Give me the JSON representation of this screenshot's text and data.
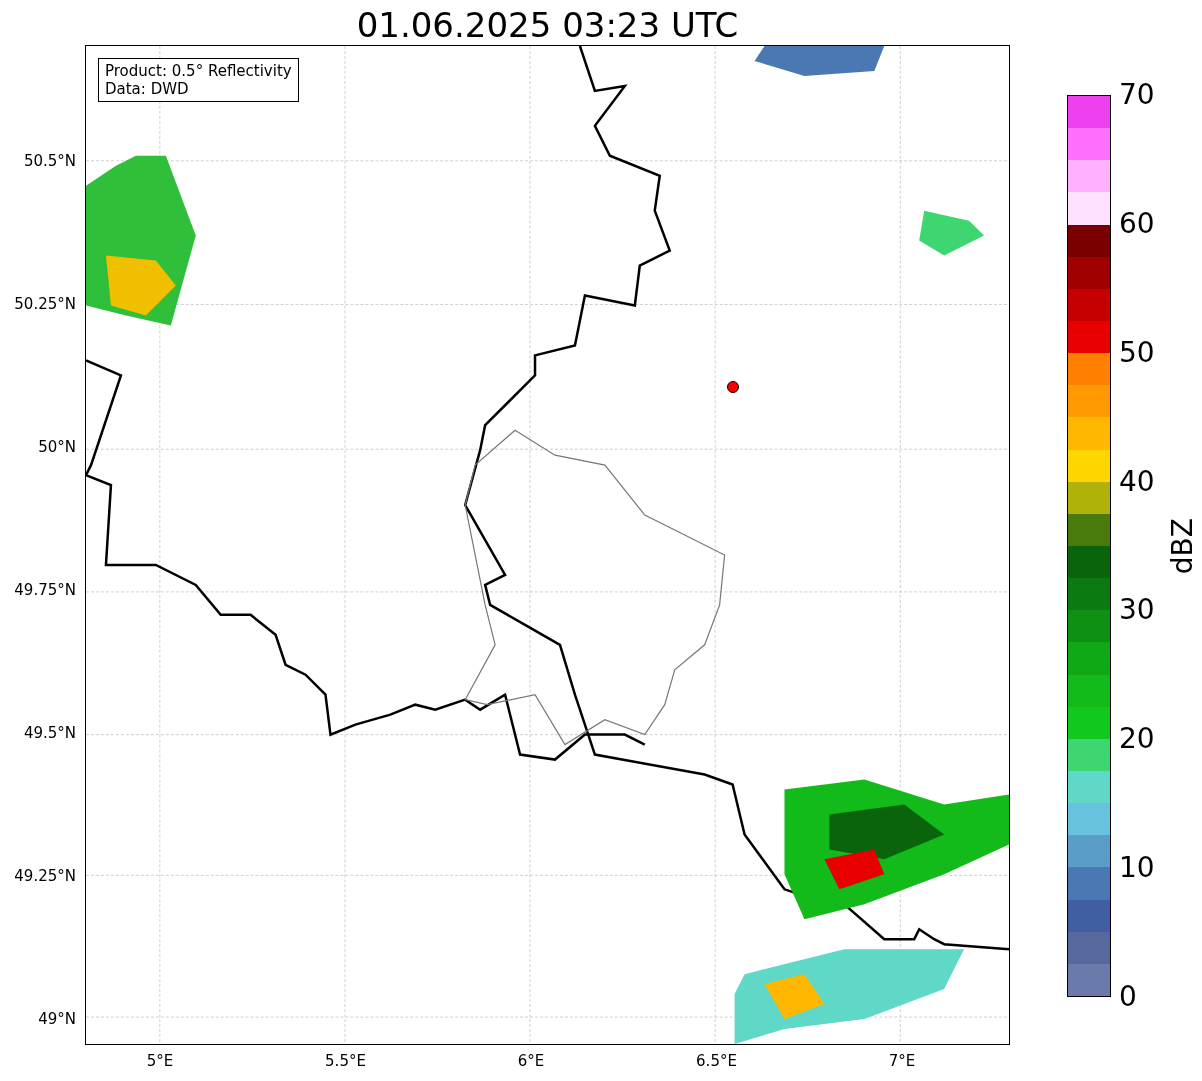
{
  "title": "01.06.2025 03:23 UTC",
  "info_box": [
    "Product: 0.5° Reflectivity",
    "Data: DWD"
  ],
  "map": {
    "x_ticks": [
      "5°E",
      "5.5°E",
      "6°E",
      "6.5°E",
      "7°E"
    ],
    "y_ticks": [
      "50.5°N",
      "50.25°N",
      "50°N",
      "49.75°N",
      "49.5°N",
      "49.25°N",
      "49°N"
    ]
  },
  "colorbar": {
    "label": "dBZ",
    "ticks": [
      "70",
      "60",
      "50",
      "40",
      "30",
      "20",
      "10",
      "0"
    ],
    "bands": [
      {
        "color": "#6a7aab"
      },
      {
        "color": "#55699f"
      },
      {
        "color": "#425ea3"
      },
      {
        "color": "#4a78b2"
      },
      {
        "color": "#5a9ec8"
      },
      {
        "color": "#66c2dd"
      },
      {
        "color": "#5fd8c8"
      },
      {
        "color": "#3dd671"
      },
      {
        "color": "#11c81f"
      },
      {
        "color": "#12bb1a"
      },
      {
        "color": "#10a814"
      },
      {
        "color": "#0e9112"
      },
      {
        "color": "#0b7a10"
      },
      {
        "color": "#0a640c"
      },
      {
        "color": "#487a0c"
      },
      {
        "color": "#b0b20a"
      },
      {
        "color": "#ffd600"
      },
      {
        "color": "#ffb700"
      },
      {
        "color": "#ff9a00"
      },
      {
        "color": "#ff7f00"
      },
      {
        "color": "#e80000"
      },
      {
        "color": "#c60000"
      },
      {
        "color": "#a00000"
      },
      {
        "color": "#7a0000"
      },
      {
        "color": "#ffe0ff"
      },
      {
        "color": "#ffb0ff"
      },
      {
        "color": "#ff70ff"
      },
      {
        "color": "#ee40ee"
      }
    ]
  }
}
